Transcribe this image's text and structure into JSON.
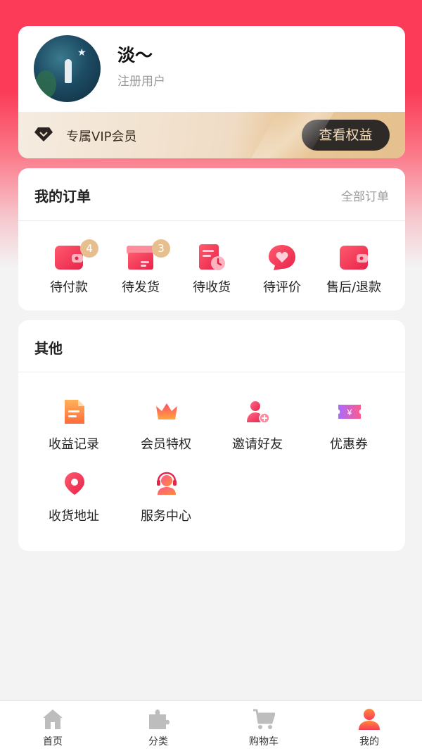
{
  "profile": {
    "name": "淡～",
    "role": "注册用户",
    "vip_label": "专属VIP会员",
    "vip_button": "查看权益"
  },
  "orders": {
    "title": "我的订单",
    "all_link": "全部订单",
    "items": [
      {
        "label": "待付款",
        "badge": "4",
        "icon": "wallet-icon"
      },
      {
        "label": "待发货",
        "badge": "3",
        "icon": "box-icon"
      },
      {
        "label": "待收货",
        "icon": "receipt-clock-icon"
      },
      {
        "label": "待评价",
        "icon": "heart-chat-icon"
      },
      {
        "label": "售后/退款",
        "icon": "refund-wallet-icon"
      }
    ]
  },
  "other": {
    "title": "其他",
    "items": [
      {
        "label": "收益记录",
        "icon": "document-icon"
      },
      {
        "label": "会员特权",
        "icon": "crown-icon"
      },
      {
        "label": "邀请好友",
        "icon": "add-user-icon"
      },
      {
        "label": "优惠券",
        "icon": "coupon-icon"
      },
      {
        "label": "收货地址",
        "icon": "location-pin-icon"
      },
      {
        "label": "服务中心",
        "icon": "headset-icon"
      }
    ]
  },
  "nav": {
    "items": [
      {
        "label": "首页",
        "icon": "home-icon"
      },
      {
        "label": "分类",
        "icon": "puzzle-icon"
      },
      {
        "label": "购物车",
        "icon": "cart-icon"
      },
      {
        "label": "我的",
        "icon": "user-icon",
        "active": true
      }
    ]
  },
  "colors": {
    "brand": "#fb3b57",
    "gold": "#e7bf8f",
    "vip_button_bg": "#2e2a28"
  }
}
